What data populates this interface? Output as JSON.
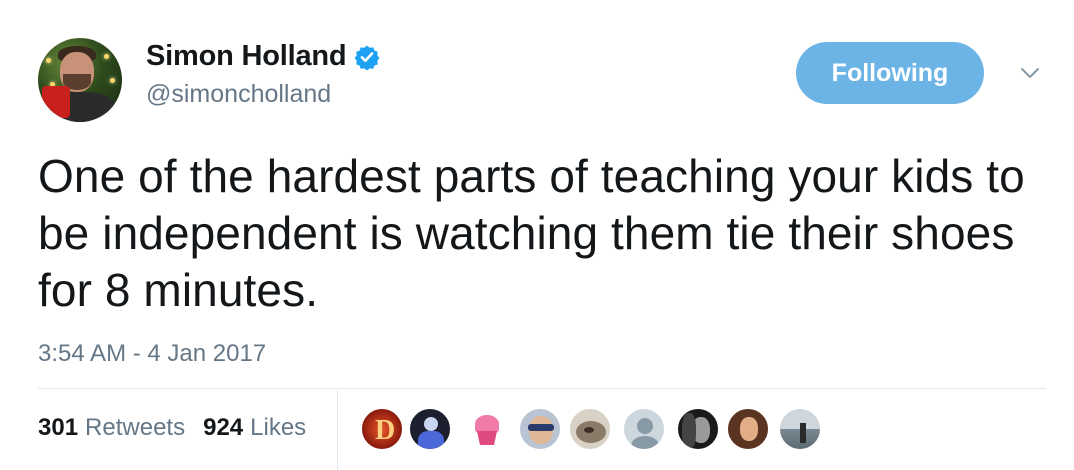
{
  "tweet": {
    "author_name": "Simon Holland",
    "author_handle": "@simoncholland",
    "verified_icon": "verified-badge-icon",
    "follow_button_label": "Following",
    "menu_icon": "chevron-down-icon",
    "text": "One of the hardest parts of teaching your kids to be independent is watching them tie their shoes for 8 minutes.",
    "timestamp": "3:54 AM - 4 Jan 2017",
    "retweets_count": "301",
    "retweets_label": "Retweets",
    "likes_count": "924",
    "likes_label": "Likes",
    "liker_avatars": [
      "liker-avatar-d",
      "liker-avatar-blue-figure",
      "liker-avatar-cupcake",
      "liker-avatar-glasses",
      "liker-avatar-dog",
      "liker-avatar-default",
      "liker-avatar-bw-portrait",
      "liker-avatar-woman",
      "liker-avatar-beach"
    ]
  },
  "colors": {
    "accent": "#1da1f2",
    "follow_button": "#6db4e6",
    "secondary_text": "#657786",
    "primary_text": "#14171a",
    "divider": "#e1e8ed"
  }
}
